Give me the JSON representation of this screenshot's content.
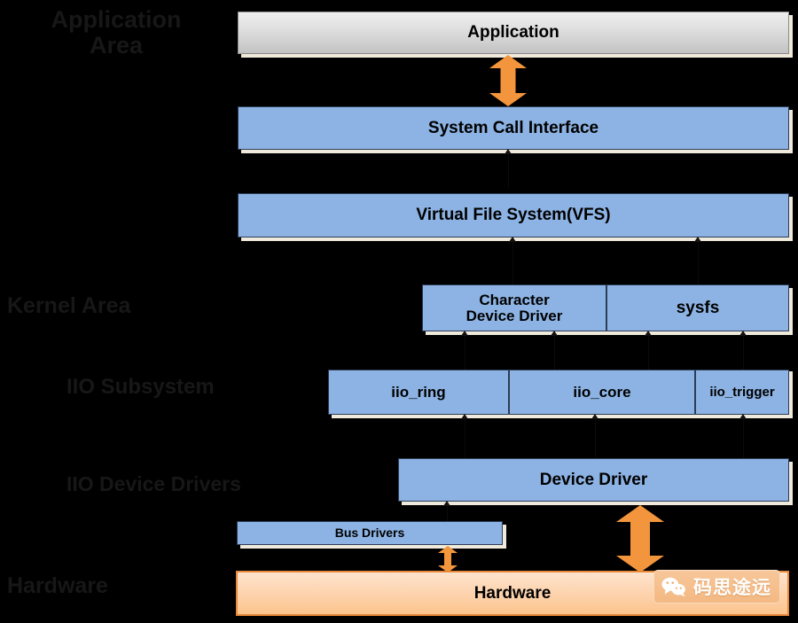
{
  "diagram": {
    "title_text_visible": false,
    "tiers": [
      {
        "name": "application-area",
        "label": "Application\nArea"
      },
      {
        "name": "kernel-area",
        "label": "Kernel Area"
      },
      {
        "name": "iio-subsystem",
        "label": "IIO Subsystem"
      },
      {
        "name": "iio-device-drivers",
        "label": "IIO Device Drivers"
      },
      {
        "name": "hardware",
        "label": "Hardware"
      }
    ],
    "boxes": {
      "application": "Application",
      "system_call_interface": "System Call Interface",
      "virtual_file_system": "Virtual File System(VFS)",
      "character_device_driver": "Character\nDevice Driver",
      "sysfs": "sysfs",
      "iio_ring": "iio_ring",
      "iio_core": "iio_core",
      "iio_trigger": "iio_trigger",
      "device_driver": "Device Driver",
      "bus_drivers": "Bus Drivers",
      "hardware": "Hardware"
    },
    "arrows": [
      {
        "name": "app-to-syscall-arrow",
        "direction": "bidirectional"
      },
      {
        "name": "devicedriver-to-hardware-arrow",
        "direction": "bidirectional"
      },
      {
        "name": "busdrivers-to-hardware-arrow",
        "direction": "bidirectional"
      }
    ],
    "colors": {
      "background": "#000000",
      "kernel_box_fill": "#8cb3e3",
      "kernel_box_border": "#2d3c57",
      "application_box_fill": "#e2e2e2",
      "hardware_box_fill": "#fdd2ab",
      "hardware_box_border": "#e8883a",
      "arrow_orange": "#f3953c",
      "box_shadow": "#efeadb",
      "tier_label_text": "#171717"
    }
  },
  "watermark": {
    "icon": "wechat-icon",
    "text": "码思途远"
  }
}
